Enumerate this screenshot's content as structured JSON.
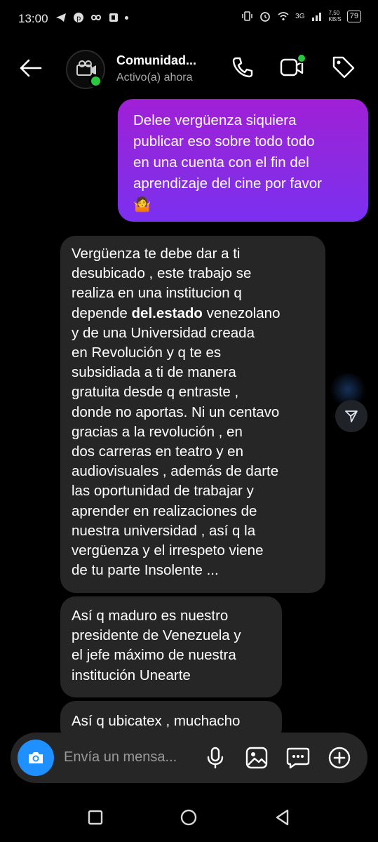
{
  "status_bar": {
    "time": "13:00",
    "network": "3G",
    "speed_top": "7,50",
    "speed_bottom": "KB/S",
    "battery": "79"
  },
  "header": {
    "contact_name": "Comunidad...",
    "status_text": "Activo(a) ahora",
    "icons": [
      "back-arrow-icon",
      "phone-icon",
      "video-call-icon",
      "tag-icon"
    ]
  },
  "messages": {
    "outgoing": {
      "lines": [
        "Delee vergüenza siquiera",
        "publicar eso sobre todo  todo",
        "en una cuenta con el fin del",
        "aprendizaje del cine  por favor",
        "🤷"
      ]
    },
    "incoming_1": {
      "lines": [
        "Vergüenza te debe dar a ti",
        "desubicado , este trabajo se",
        "realiza en una institucion q"
      ],
      "line4_pre": "depende ",
      "line4_bold": "del.estado",
      "line4_post": " venezolano",
      "lines_rest": [
        "y de una Universidad creada",
        "en Revolución y q te es",
        "subsidiada a ti de manera",
        "gratuita desde q entraste ,",
        "donde no aportas. Ni un centavo",
        "gracias a la revolución , en",
        "dos carreras en teatro y en",
        "audiovisuales , además de darte",
        "las oportunidad de trabajar y",
        "aprender en realizaciones de",
        "nuestra universidad , así q la",
        "vergüenza y el irrespeto viene",
        "de tu parte Insolente ..."
      ]
    },
    "incoming_2": {
      "lines": [
        "Así q maduro es nuestro",
        "presidente de Venezuela y",
        "el jefe máximo de nuestra",
        "institución Unearte"
      ]
    },
    "incoming_3": {
      "lines": [
        "Así q ubicatex , muchacho"
      ]
    }
  },
  "composer": {
    "placeholder": "Envía un mensa..."
  },
  "colors": {
    "outgoing_bubble": "#8a2be2",
    "incoming_bubble": "#262626",
    "camera_button": "#1e90ff",
    "online": "#27c93f"
  }
}
